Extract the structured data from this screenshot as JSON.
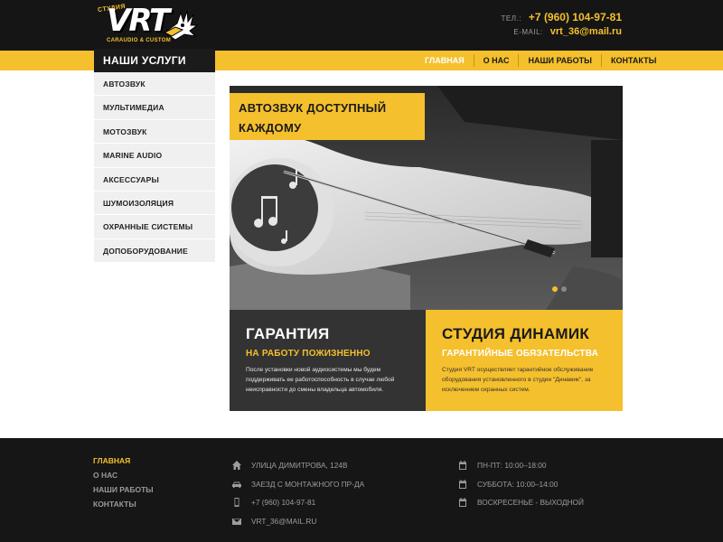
{
  "header": {
    "logo": {
      "studio": "СТУДИЯ",
      "brand": "VRT",
      "tagline": "CARAUDIO & CUSTOM"
    },
    "phone_label": "ТЕЛ.:",
    "phone": "+7 (960) 104-97-81",
    "email_label": "E-MAIL:",
    "email": "vrt_36@mail.ru"
  },
  "nav": {
    "items": [
      {
        "label": "ГЛАВНАЯ"
      },
      {
        "label": "О НАС"
      },
      {
        "label": "НАШИ РАБОТЫ"
      },
      {
        "label": "КОНТАКТЫ"
      }
    ]
  },
  "sidebar": {
    "title": "НАШИ УСЛУГИ",
    "items": [
      {
        "label": "АВТОЗВУК"
      },
      {
        "label": "МУЛЬТИМЕДИА"
      },
      {
        "label": "МОТОЗВУК"
      },
      {
        "label": "MARINE AUDIO"
      },
      {
        "label": "АКСЕССУАРЫ"
      },
      {
        "label": "ШУМОИЗОЛЯЦИЯ"
      },
      {
        "label": "ОХРАННЫЕ СИСТЕМЫ"
      },
      {
        "label": "ДОПОБОРУДОВАНИЕ"
      }
    ]
  },
  "hero": {
    "title_line1": "АВТОЗВУК ДОСТУПНЫЙ",
    "title_line2": "КАЖДОМУ",
    "slides_total": 2,
    "active_slide": 1
  },
  "blocks": {
    "warranty": {
      "title": "ГАРАНТИЯ",
      "subtitle": "НА РАБОТУ ПОЖИЗНЕННО",
      "text": "После установки новой аудиосистемы мы будем поддерживать ее работоспособность в случае любой неисправности до смены владельца автомобиля."
    },
    "studio": {
      "title": "СТУДИЯ ДИНАМИК",
      "subtitle": "ГАРАНТИЙНЫЕ ОБЯЗАТЕЛЬСТВА",
      "text": "Студия VRT осуществляет гарантийное обслуживание оборудования установленного в студии \"Динамик\", за исключением охранных систем."
    }
  },
  "footer": {
    "nav": [
      {
        "label": "ГЛАВНАЯ"
      },
      {
        "label": "О НАС"
      },
      {
        "label": "НАШИ РАБОТЫ"
      },
      {
        "label": "КОНТАКТЫ"
      }
    ],
    "contacts": [
      {
        "icon": "home-icon",
        "text": "УЛИЦА ДИМИТРОВА, 124В"
      },
      {
        "icon": "car-icon",
        "text": "ЗАЕЗД С МОНТАЖНОГО ПР-ДА"
      },
      {
        "icon": "phone-icon",
        "text": "+7 (960) 104-97-81"
      },
      {
        "icon": "mail-icon",
        "text": "VRT_36@MAIL.RU"
      }
    ],
    "hours": [
      {
        "icon": "calendar-icon",
        "text": "ПН-ПТ: 10:00–18:00"
      },
      {
        "icon": "calendar-icon",
        "text": "СУББОТА: 10:00–14:00"
      },
      {
        "icon": "calendar-icon",
        "text": "ВОСКРЕСЕНЬЕ - ВЫХОДНОЙ"
      }
    ]
  },
  "colors": {
    "accent": "#f5c02d",
    "dark": "#151515",
    "panel": "#333333"
  }
}
